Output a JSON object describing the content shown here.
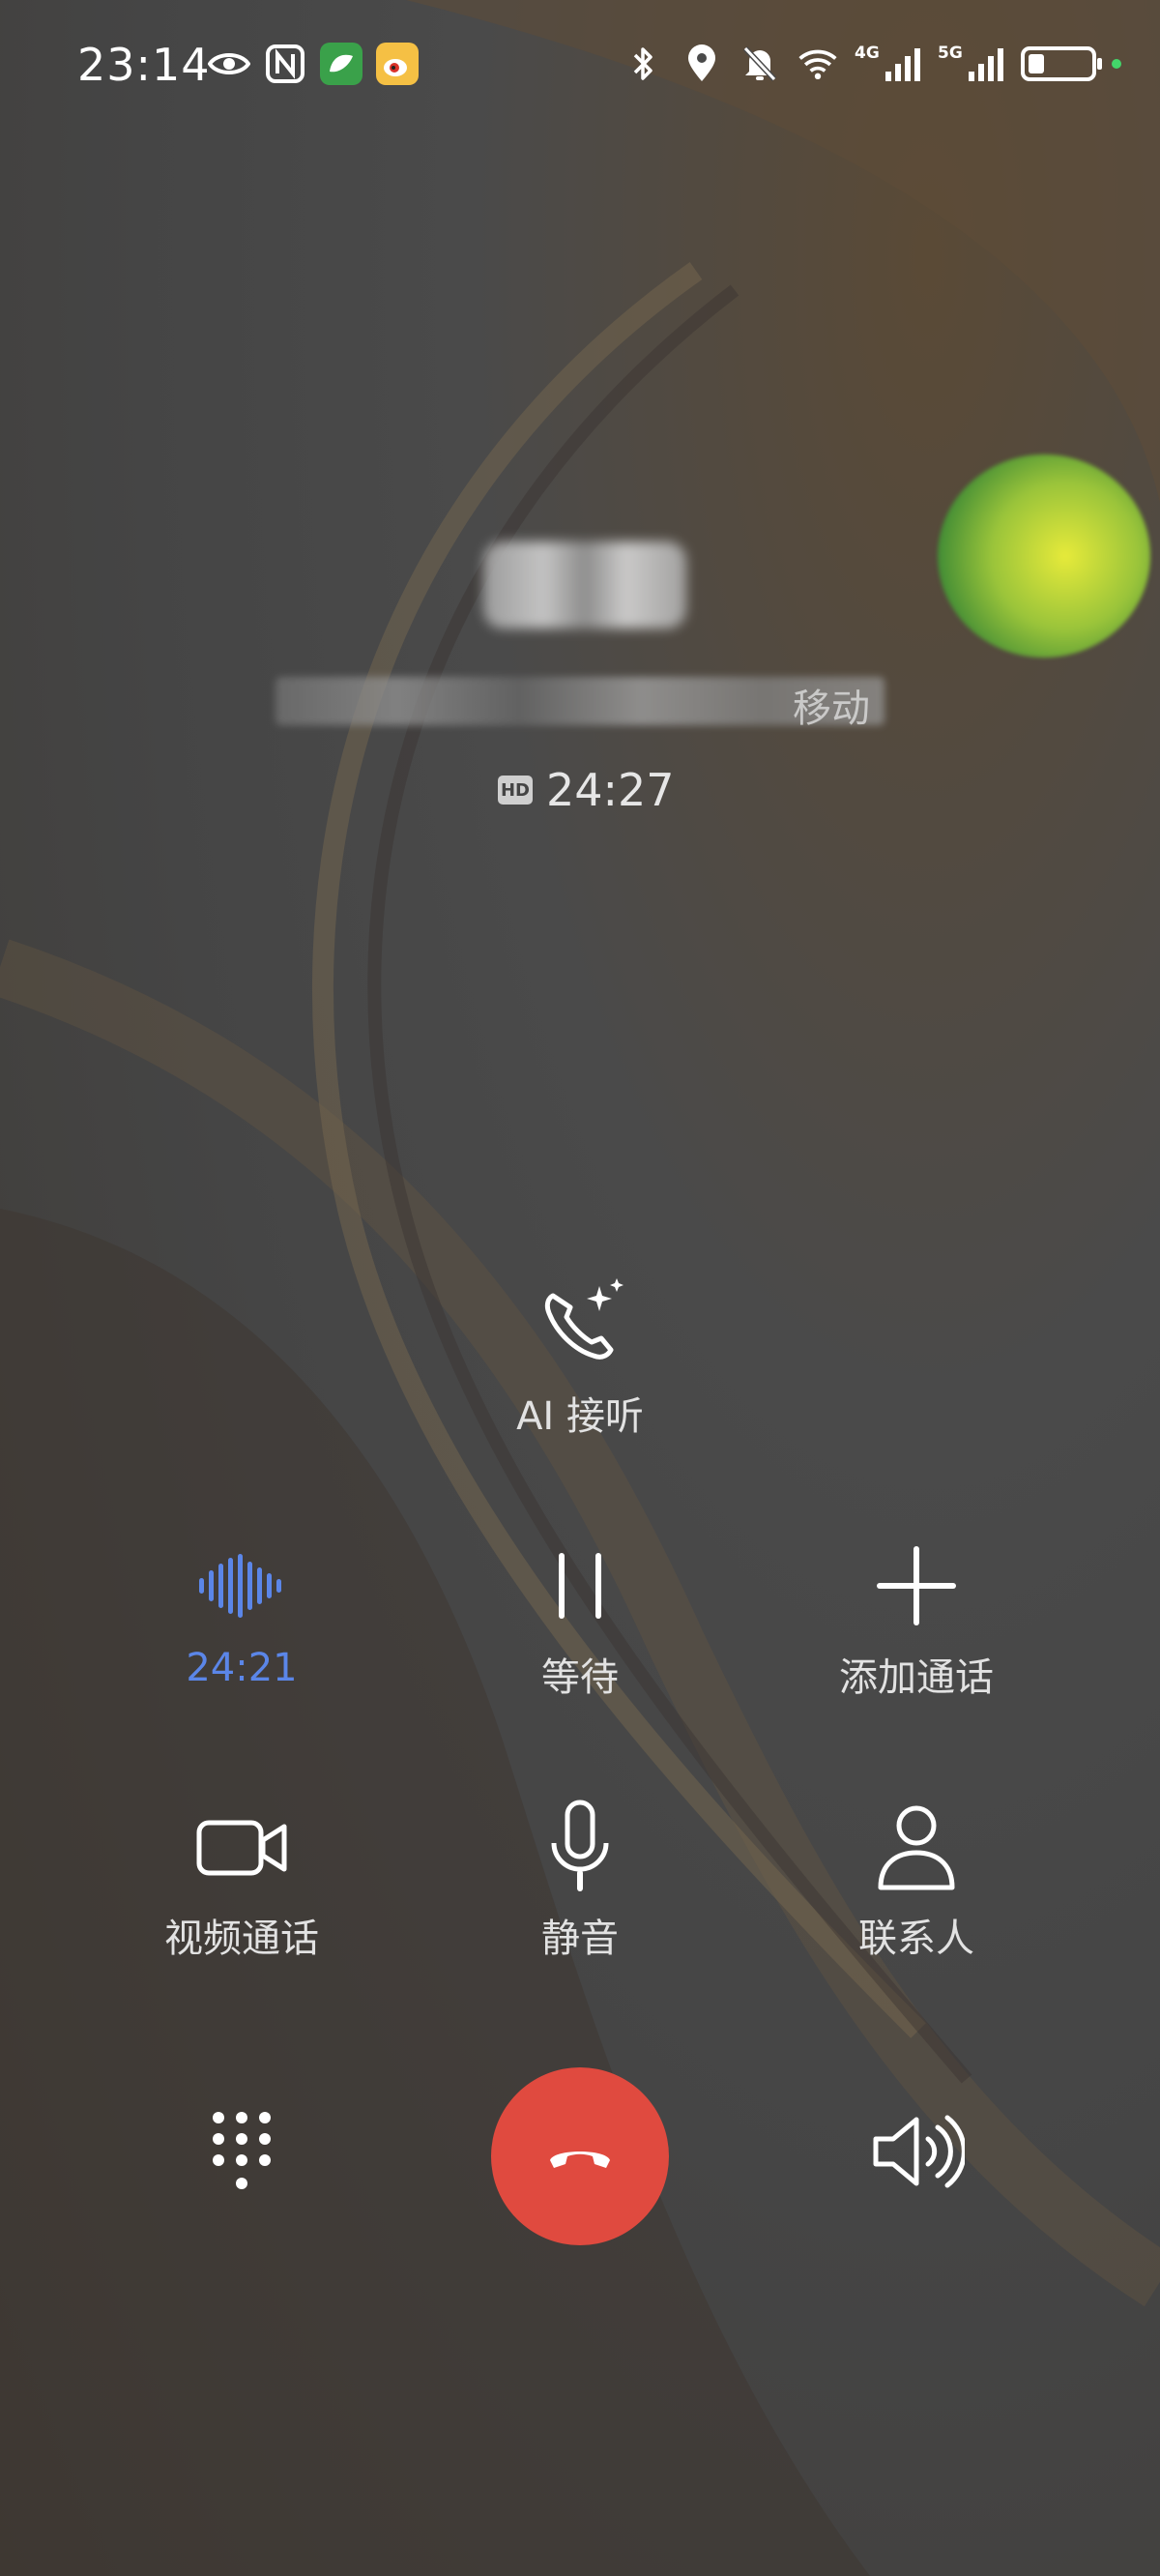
{
  "status_bar": {
    "time": "23:14",
    "left_icons": [
      "eye-icon",
      "nfc-icon",
      "app-green-icon",
      "weibo-icon"
    ],
    "right_icons": [
      "bluetooth-icon",
      "location-icon",
      "mute-bell-icon",
      "wifi-icon",
      "signal-4g-icon",
      "signal-5g-icon",
      "battery-icon"
    ],
    "signal_labels": {
      "four_g": "4G",
      "five_g": "5G"
    },
    "battery_level_percent": 25
  },
  "caller": {
    "name": "",
    "carrier_suffix": "移动",
    "hd_badge": "HD",
    "call_duration": "24:27"
  },
  "ai_answer": {
    "label": "AI 接听"
  },
  "controls": {
    "recording": {
      "label": "24:21",
      "icon": "voice-wave-icon"
    },
    "hold": {
      "label": "等待",
      "icon": "pause-icon"
    },
    "add_call": {
      "label": "添加通话",
      "icon": "plus-icon"
    },
    "video_call": {
      "label": "视频通话",
      "icon": "video-icon"
    },
    "mute": {
      "label": "静音",
      "icon": "microphone-icon"
    },
    "contacts": {
      "label": "联系人",
      "icon": "person-icon"
    }
  },
  "bottom_bar": {
    "dialpad": "dialpad-icon",
    "end_call": "hang-up-icon",
    "speaker": "speaker-icon"
  },
  "colors": {
    "accent_blue": "#5b86e8",
    "end_call_red": "#e04a3f",
    "status_dot_green": "#43d66a"
  }
}
